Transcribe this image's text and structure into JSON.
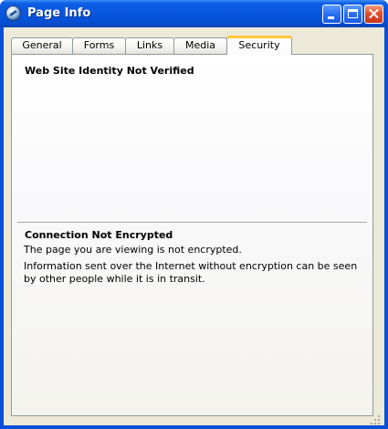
{
  "window": {
    "title": "Page Info",
    "icon": "network-globe-icon",
    "controls": [
      "minimize",
      "maximize",
      "close"
    ]
  },
  "tabs": [
    {
      "label": "General",
      "active": false
    },
    {
      "label": "Forms",
      "active": false
    },
    {
      "label": "Links",
      "active": false
    },
    {
      "label": "Media",
      "active": false
    },
    {
      "label": "Security",
      "active": true
    }
  ],
  "security": {
    "identity_heading": "Web Site Identity Not Verified",
    "connection_heading": "Connection Not Encrypted",
    "connection_line1": "The page you are viewing is not encrypted.",
    "connection_line2": "Information sent over the Internet without encryption can be seen by other people while it is in transit."
  },
  "colors": {
    "titlebar": "#0854dd",
    "active_tab_accent": "#ffc73c",
    "client_bg": "#ece9d8",
    "close_button": "#e0502a"
  }
}
